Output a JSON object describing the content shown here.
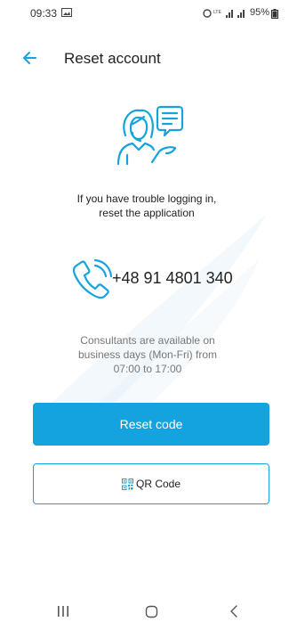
{
  "status_bar": {
    "time": "09:33",
    "battery": "95%"
  },
  "header": {
    "title": "Reset account"
  },
  "main": {
    "intro_line1": "If you have trouble logging in,",
    "intro_line2": "reset the application",
    "phone": "+48 91 4801 340",
    "hours_line1": "Consultants are available on",
    "hours_line2": "business days (Mon-Fri) from",
    "hours_line3": "07:00 to 17:00",
    "reset_label": "Reset code",
    "qr_label": "QR Code"
  },
  "icons": {
    "back": "arrow-left-icon",
    "consultant": "consultant-chat-icon",
    "phone": "phone-ringing-icon",
    "qr": "qr-code-icon"
  },
  "colors": {
    "accent": "#14a3de",
    "text": "#222222",
    "muted": "#777777"
  }
}
